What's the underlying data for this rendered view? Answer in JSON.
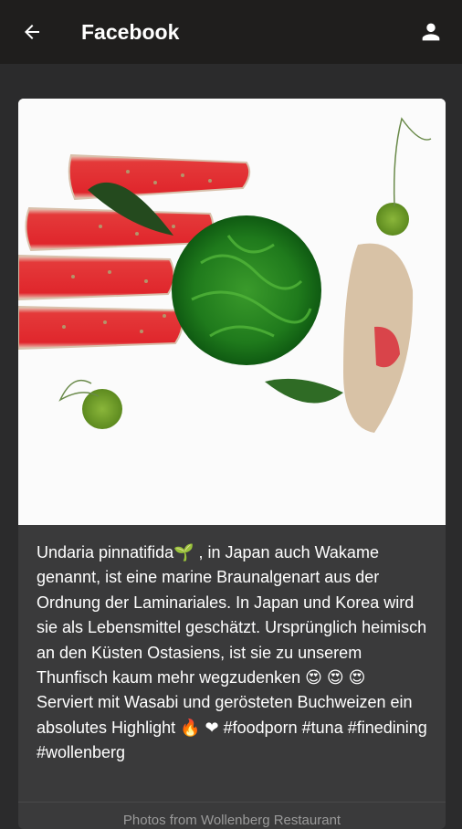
{
  "appbar": {
    "title": "Facebook",
    "back_icon": "arrow-left-icon",
    "account_icon": "person-icon"
  },
  "post": {
    "image_description_icon": "food-photo",
    "text": "Undaria pinnatifida🌱 , in Japan auch Wakame genannt, ist eine marine Braunalgenart aus der Ordnung der Laminariales. In Japan und Korea wird sie als Lebensmittel geschätzt. Ursprünglich heimisch an den Küsten Ostasiens, ist sie zu unserem Thunfisch kaum mehr wegzudenken 😍 😍 😍  Serviert mit Wasabi und gerösteten Buchweizen ein absolutes Highlight 🔥 ❤ #foodporn #tuna #finedining #wollenberg",
    "footer": "Photos from Wollenberg Restaurant"
  },
  "colors": {
    "appbar": "#1f1e1d",
    "background": "#2b2b2c",
    "card": "#3a3a3b"
  }
}
